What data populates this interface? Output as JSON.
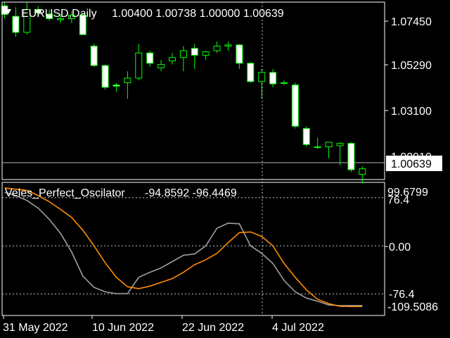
{
  "symbol_header": {
    "symbol": "EURUSD,Daily",
    "ohlc": "1.00400 1.00738 1.00000 1.00639"
  },
  "indicator_header": {
    "name": "Veles_Perfect_Oscilator",
    "values": "-94.8592 -96.4469"
  },
  "price_axis": {
    "ticks": [
      "1.07450",
      "1.05290",
      "1.03100",
      "1.00910"
    ],
    "current_price": "1.00639"
  },
  "indicator_axis": {
    "top_value": "99.6799",
    "levels": [
      "76.4",
      "0.00",
      "-76.4"
    ],
    "bottom_value": "-109.5086"
  },
  "time_axis": {
    "labels": [
      "31 May 2022",
      "10 Jun 2022",
      "22 Jun 2022",
      "4 Jul 2022"
    ]
  },
  "colors": {
    "background": "#000000",
    "bull_candle": "#00ff00",
    "bear_body": "#ffffff",
    "oscillator_fast": "#a0a0a0",
    "oscillator_slow": "#ff8c00"
  },
  "chart_data": [
    {
      "type": "candlestick",
      "title": "EURUSD,Daily",
      "ylim": [
        1.002,
        1.0789
      ],
      "candles": [
        {
          "o": 1.0776,
          "h": 1.079,
          "l": 1.072,
          "c": 1.0738
        },
        {
          "o": 1.073,
          "h": 1.077,
          "l": 1.064,
          "c": 1.066
        },
        {
          "o": 1.066,
          "h": 1.079,
          "l": 1.065,
          "c": 1.076
        },
        {
          "o": 1.076,
          "h": 1.0775,
          "l": 1.074,
          "c": 1.0745
        },
        {
          "o": 1.074,
          "h": 1.076,
          "l": 1.071,
          "c": 1.072
        },
        {
          "o": 1.0715,
          "h": 1.074,
          "l": 1.07,
          "c": 1.072
        },
        {
          "o": 1.072,
          "h": 1.075,
          "l": 1.07,
          "c": 1.0735
        },
        {
          "o": 1.0735,
          "h": 1.0745,
          "l": 1.065,
          "c": 1.065
        },
        {
          "o": 1.06,
          "h": 1.061,
          "l": 1.051,
          "c": 1.0515
        },
        {
          "o": 1.0515,
          "h": 1.052,
          "l": 1.041,
          "c": 1.042
        },
        {
          "o": 1.043,
          "h": 1.044,
          "l": 1.04,
          "c": 1.0425
        },
        {
          "o": 1.044,
          "h": 1.049,
          "l": 1.037,
          "c": 1.046
        },
        {
          "o": 1.046,
          "h": 1.061,
          "l": 1.045,
          "c": 1.057
        },
        {
          "o": 1.057,
          "h": 1.058,
          "l": 1.051,
          "c": 1.0525
        },
        {
          "o": 1.0505,
          "h": 1.054,
          "l": 1.049,
          "c": 1.052
        },
        {
          "o": 1.0535,
          "h": 1.057,
          "l": 1.052,
          "c": 1.055
        },
        {
          "o": 1.055,
          "h": 1.06,
          "l": 1.049,
          "c": 1.058
        },
        {
          "o": 1.059,
          "h": 1.061,
          "l": 1.05,
          "c": 1.056
        },
        {
          "o": 1.056,
          "h": 1.058,
          "l": 1.054,
          "c": 1.0575
        },
        {
          "o": 1.058,
          "h": 1.062,
          "l": 1.057,
          "c": 1.06
        },
        {
          "o": 1.06,
          "h": 1.062,
          "l": 1.058,
          "c": 1.0605
        },
        {
          "o": 1.0605,
          "h": 1.061,
          "l": 1.05,
          "c": 1.0525
        },
        {
          "o": 1.0525,
          "h": 1.053,
          "l": 1.044,
          "c": 1.0445
        },
        {
          "o": 1.0445,
          "h": 1.05,
          "l": 1.037,
          "c": 1.0485
        },
        {
          "o": 1.0485,
          "h": 1.05,
          "l": 1.042,
          "c": 1.0435
        },
        {
          "o": 1.044,
          "h": 1.045,
          "l": 1.043,
          "c": 1.044
        },
        {
          "o": 1.043,
          "h": 1.044,
          "l": 1.024,
          "c": 1.025
        },
        {
          "o": 1.024,
          "h": 1.025,
          "l": 1.016,
          "c": 1.017
        },
        {
          "o": 1.016,
          "h": 1.02,
          "l": 1.015,
          "c": 1.016
        },
        {
          "o": 1.016,
          "h": 1.017,
          "l": 1.011,
          "c": 1.018
        },
        {
          "o": 1.0165,
          "h": 1.018,
          "l": 1.008,
          "c": 1.0175
        },
        {
          "o": 1.0175,
          "h": 1.018,
          "l": 1.005,
          "c": 1.006
        },
        {
          "o": 1.004,
          "h": 1.0074,
          "l": 1.0,
          "c": 1.0064
        }
      ]
    },
    {
      "type": "line",
      "title": "Veles_Perfect_Oscilator",
      "ylim": [
        -109.5086,
        99.6799
      ],
      "levels": [
        76.4,
        0,
        -76.4
      ],
      "series": [
        {
          "name": "",
          "color": "#a0a0a0",
          "values": [
            85,
            80,
            72,
            60,
            42,
            20,
            -10,
            -48,
            -66,
            -73,
            -76,
            -76,
            -50,
            -42,
            -35,
            -25,
            -15,
            -13,
            0,
            28,
            36,
            35,
            0,
            -12,
            -28,
            -55,
            -73,
            -83,
            -88,
            -94,
            -95,
            -94.8592,
            -94.8592
          ]
        },
        {
          "name": "",
          "color": "#ff8c00",
          "values": [
            92,
            90,
            88,
            80,
            70,
            58,
            45,
            25,
            0,
            -27,
            -50,
            -65,
            -68,
            -64,
            -58,
            -52,
            -42,
            -30,
            -22,
            -12,
            5,
            21,
            22,
            15,
            0,
            -28,
            -50,
            -70,
            -85,
            -92,
            -96,
            -96.4469,
            -96.4469
          ]
        }
      ]
    }
  ]
}
